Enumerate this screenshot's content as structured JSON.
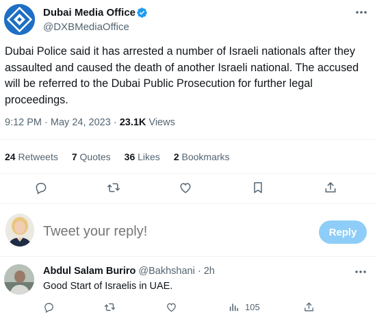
{
  "author": {
    "display_name": "Dubai Media Office",
    "handle": "@DXBMediaOffice",
    "verified_color": "#1d9bf0",
    "avatar_color": "#1e6fc4"
  },
  "tweet": {
    "text": "Dubai Police said it has arrested a number of Israeli nationals after they assaulted and caused the death of another Israeli national. The accused will be referred to the Dubai Public Prosecution for further legal proceedings.",
    "time": "9:12 PM",
    "date": "May 24, 2023",
    "separator": "·",
    "views_count": "23.1K",
    "views_label": "Views"
  },
  "stats": {
    "retweets_count": "24",
    "retweets_label": "Retweets",
    "quotes_count": "7",
    "quotes_label": "Quotes",
    "likes_count": "36",
    "likes_label": "Likes",
    "bookmarks_count": "2",
    "bookmarks_label": "Bookmarks"
  },
  "actions": [
    "reply-icon",
    "retweet-icon",
    "like-icon",
    "bookmark-icon",
    "share-icon"
  ],
  "reply_box": {
    "placeholder": "Tweet your reply!",
    "button_label": "Reply",
    "button_color": "#8ecdf8"
  },
  "reply": {
    "name": "Abdul Salam Buriro",
    "handle": "@Bakhshani",
    "separator": "·",
    "time": "2h",
    "text": "Good Start of Israelis in UAE.",
    "views_count": "105"
  },
  "colors": {
    "text_primary": "#0f1419",
    "text_secondary": "#536471",
    "divider": "#eff3f4",
    "accent": "#1d9bf0"
  }
}
